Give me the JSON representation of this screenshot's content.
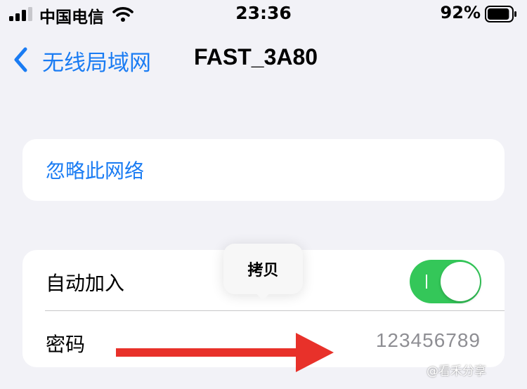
{
  "status_bar": {
    "carrier": "中国电信",
    "time": "23:36",
    "battery": "92%",
    "battery_level": 0.92,
    "signal_bars": 3,
    "icons": [
      "signal-icon",
      "wifi-icon",
      "battery-icon"
    ]
  },
  "nav": {
    "back_label": "无线局域网",
    "title": "FAST_3A80",
    "back_icon": "chevron-left-icon"
  },
  "forget": {
    "label": "忽略此网络"
  },
  "settings": {
    "auto_join": {
      "label": "自动加入",
      "enabled": true
    },
    "password": {
      "label": "密码",
      "value": "123456789"
    }
  },
  "copy_menu": {
    "label": "拷贝"
  },
  "annotation": {
    "icon": "red-arrow-icon",
    "color": "#e8312a"
  },
  "watermark": "@看禾分享",
  "colors": {
    "accent": "#1a7cf3",
    "toggle_on": "#34c759",
    "background": "#f2f2f7"
  }
}
